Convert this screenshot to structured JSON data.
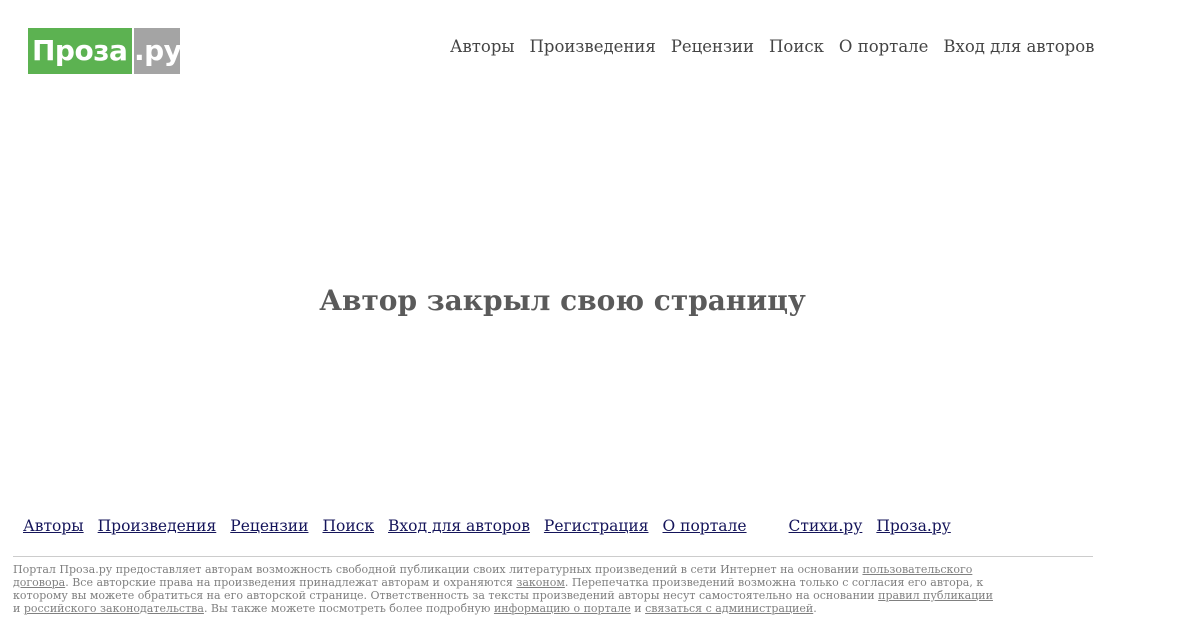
{
  "logo": {
    "green_text": "Проза",
    "gray_text": ".ру"
  },
  "top_nav": [
    {
      "label": "Авторы"
    },
    {
      "label": "Произведения"
    },
    {
      "label": "Рецензии"
    },
    {
      "label": "Поиск"
    },
    {
      "label": "О портале"
    },
    {
      "label": "Вход для авторов"
    }
  ],
  "main": {
    "message": "Автор закрыл свою страницу"
  },
  "footer_nav": [
    {
      "label": "Авторы"
    },
    {
      "label": "Произведения"
    },
    {
      "label": "Рецензии"
    },
    {
      "label": "Поиск"
    },
    {
      "label": "Вход для авторов"
    },
    {
      "label": "Регистрация"
    },
    {
      "label": "О портале"
    }
  ],
  "footer_sites": [
    {
      "label": "Стихи.ру"
    },
    {
      "label": "Проза.ру"
    }
  ],
  "disclaimer": {
    "t1": "Портал Проза.ру предоставляет авторам возможность свободной публикации своих литературных произведений в сети Интернет на основании ",
    "l1": "пользовательского договора",
    "t2": ". Все авторские права на произведения принадлежат авторам и охраняются ",
    "l2": "законом",
    "t3": ". Перепечатка произведений возможна только с согласия его автора, к которому вы можете обратиться на его авторской странице. Ответственность за тексты произведений авторы несут самостоятельно на основании ",
    "l3": "правил публикации",
    "t4": " и ",
    "l4": "российского законодательства",
    "t5": ". Вы также можете посмотреть более подробную ",
    "l5": "информацию о портале",
    "t6": " и ",
    "l6": "связаться с администрацией",
    "t7": "."
  }
}
